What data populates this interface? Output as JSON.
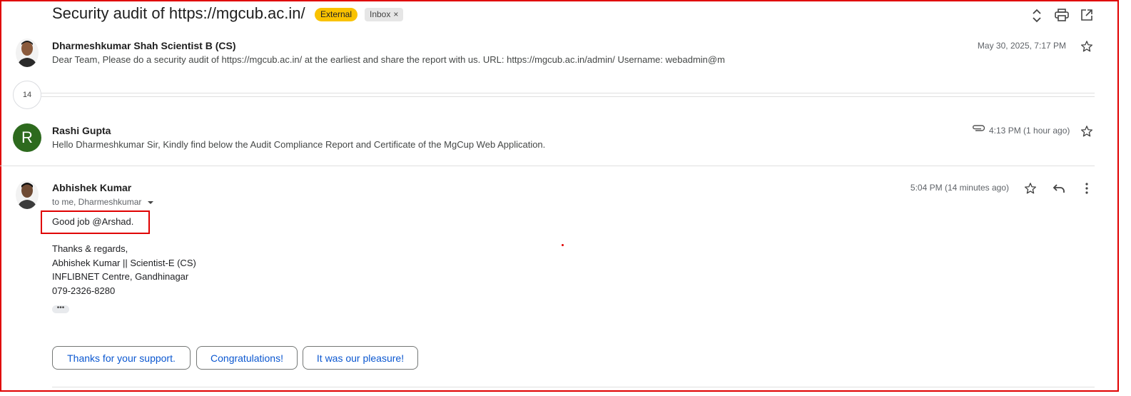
{
  "thread": {
    "subject": "Security audit of https://mgcub.ac.in/",
    "labels": {
      "external": "External",
      "inbox": "Inbox",
      "remove_glyph": "×"
    },
    "actions": [
      "expand-collapse-icon",
      "print-icon",
      "open-in-new-window-icon"
    ]
  },
  "messages": [
    {
      "sender": "Dharmeshkumar Shah Scientist B (CS)",
      "snippet": "Dear Team, Please do a security audit of https://mgcub.ac.in/ at the earliest and share the report with us. URL: https://mgcub.ac.in/admin/ Username: webadmin@m",
      "date": "May 30, 2025, 7:17 PM"
    },
    {
      "sender": "Rashi Gupta",
      "avatar_letter": "R",
      "avatar_color": "#2d6a1e",
      "snippet": "Hello Dharmeshkumar Sir, Kindly find below the Audit Compliance Report and Certificate of the MgCup Web Application.",
      "date": "4:13 PM (1 hour ago)",
      "has_attachment": true
    },
    {
      "sender": "Abhishek Kumar",
      "recipients": "to me, Dharmeshkumar",
      "date": "5:04 PM (14 minutes ago)",
      "body": {
        "greeting": "Good job @Arshad.",
        "signature": [
          "Thanks & regards,",
          "Abhishek Kumar || Scientist-E (CS)",
          "INFLIBNET Centre, Gandhinagar",
          "079-2326-8280"
        ],
        "trimmed_glyph": "•••"
      }
    }
  ],
  "collapsed_count": "14",
  "smart_replies": [
    "Thanks for your support.",
    "Congratulations!",
    "It was our pleasure!"
  ],
  "colors": {
    "accent_blue": "#0b57d0",
    "external_badge": "#f9c200",
    "annotation_red": "#e00000"
  }
}
